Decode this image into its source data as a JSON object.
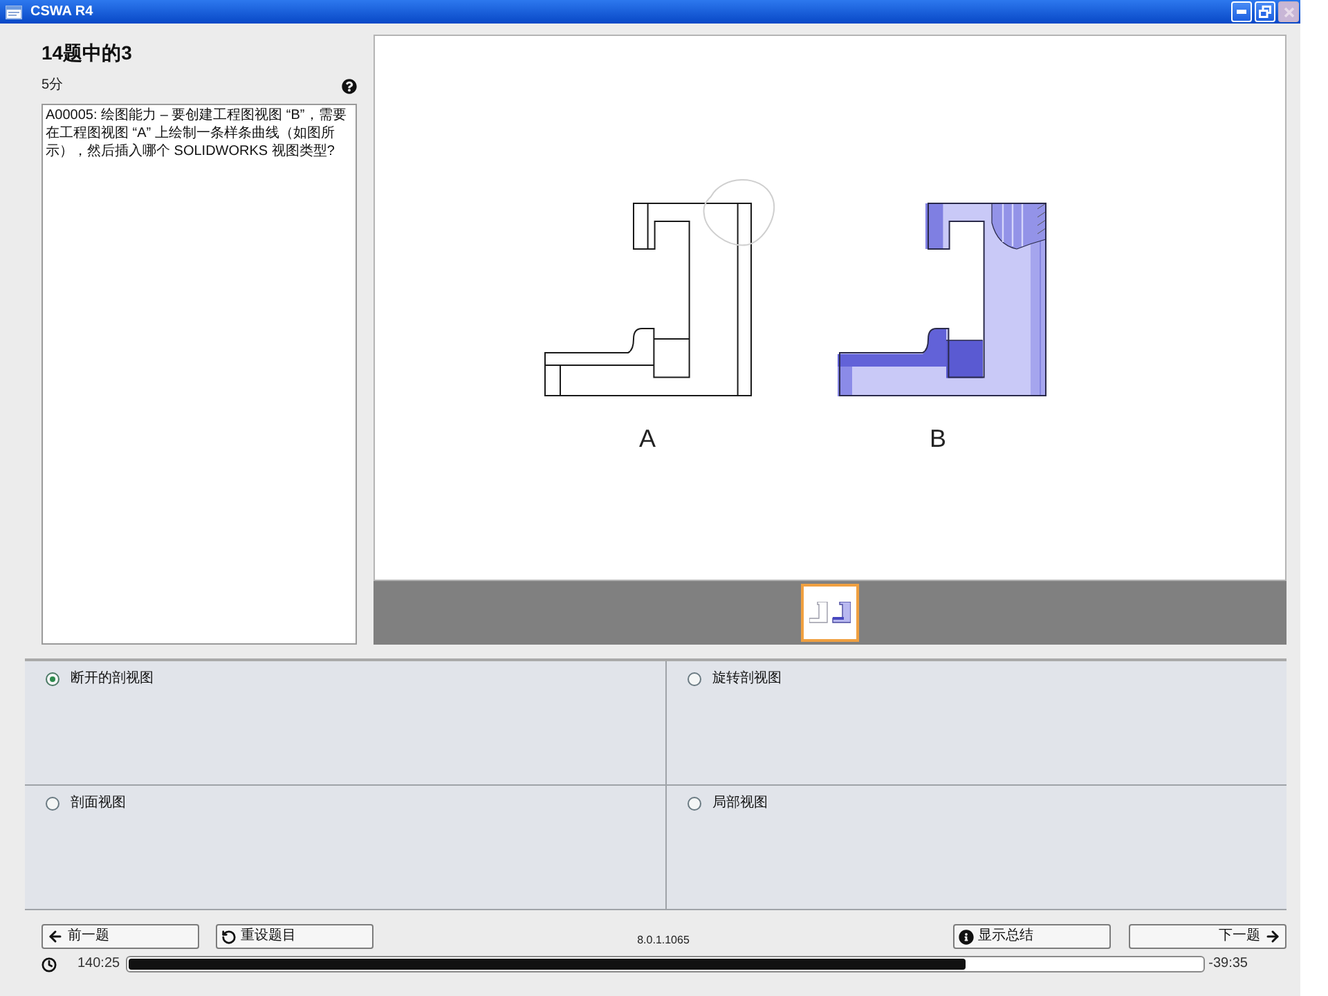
{
  "window": {
    "title": "CSWA R4",
    "controls": [
      {
        "kind": "minimize",
        "disabled": false
      },
      {
        "kind": "restore",
        "disabled": false
      },
      {
        "kind": "close",
        "disabled": true
      }
    ]
  },
  "question": {
    "title": "14题中的3",
    "points": "5分",
    "text": "A00005: 绘图能力 – 要创建工程图视图 “B”，需要在工程图视图 “A” 上绘制一条样条曲线（如图所示），然后插入哪个 SOLIDWORKS 视图类型?"
  },
  "figure": {
    "views": [
      {
        "kind": "line",
        "label": "A"
      },
      {
        "kind": "shaded",
        "label": "B"
      }
    ],
    "thumbnails": [
      {
        "selected": true
      }
    ]
  },
  "answers": [
    {
      "label": "断开的剖视图",
      "selected": true
    },
    {
      "label": "旋转剖视图",
      "selected": false
    },
    {
      "label": "剖面视图",
      "selected": false
    },
    {
      "label": "局部视图",
      "selected": false
    }
  ],
  "buttons": [
    {
      "kind": "previous",
      "label": "前一题"
    },
    {
      "kind": "reset",
      "label": "重设题目"
    },
    {
      "kind": "summary",
      "label": "显示总结"
    },
    {
      "kind": "next",
      "label": "下一题"
    }
  ],
  "version": "8.0.1.1065",
  "timer": {
    "elapsed": "140:25",
    "level": 0.78,
    "remaining": "-39:35"
  }
}
